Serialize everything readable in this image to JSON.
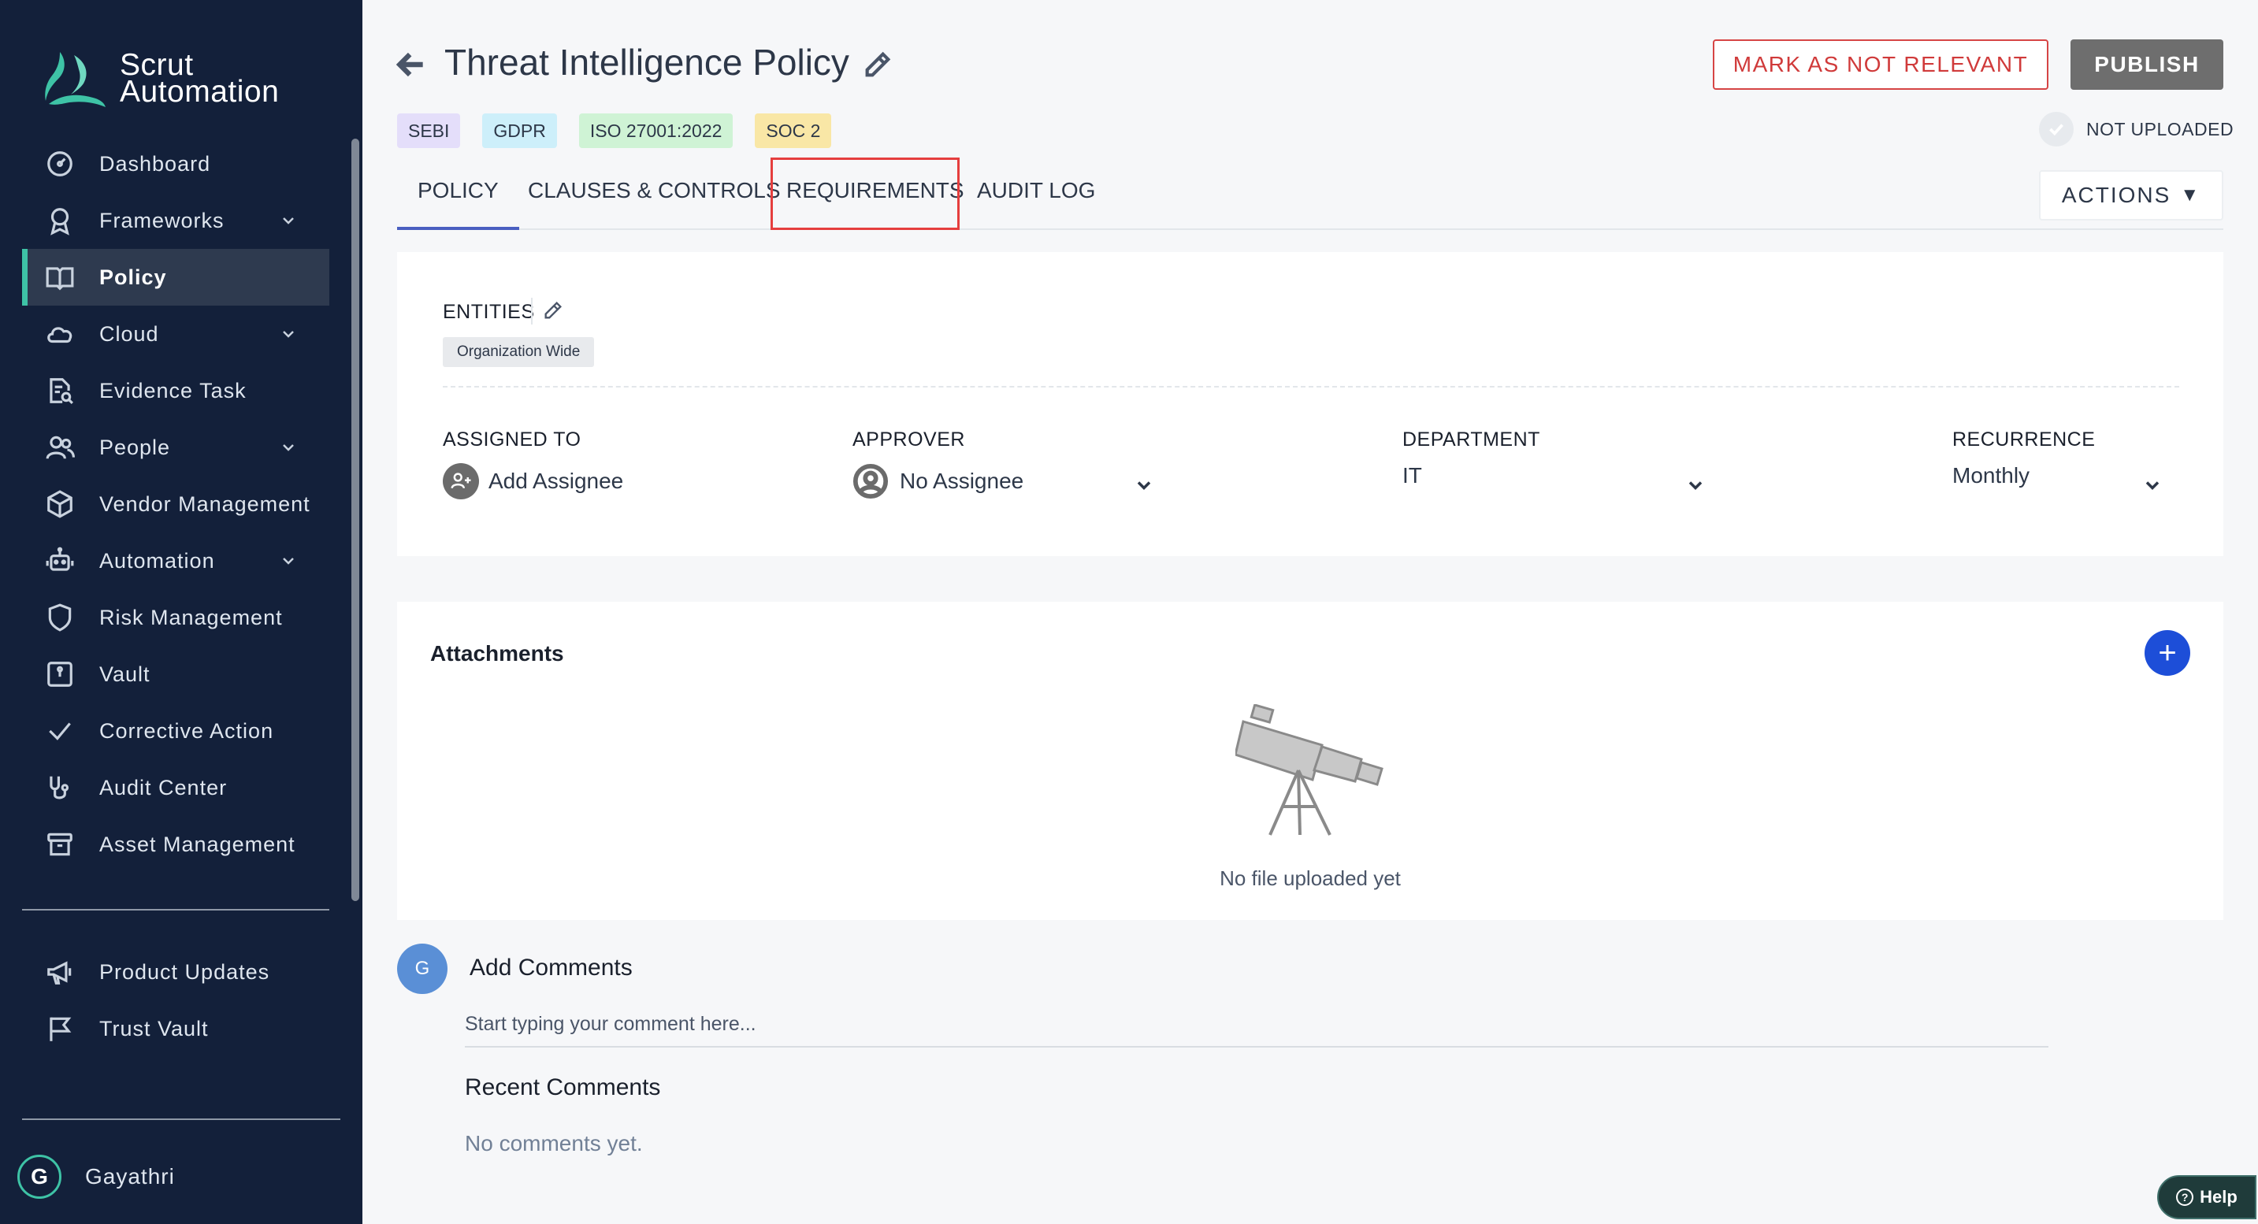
{
  "brand": {
    "line1": "Scrut",
    "line2": "Automation",
    "accent": "#3ec3a6"
  },
  "sidebar": {
    "items": [
      {
        "label": "Dashboard",
        "icon": "dashboard-gauge-icon",
        "chevron": false,
        "active": false
      },
      {
        "label": "Frameworks",
        "icon": "award-ribbon-icon",
        "chevron": true,
        "active": false
      },
      {
        "label": "Policy",
        "icon": "open-book-icon",
        "chevron": false,
        "active": true
      },
      {
        "label": "Cloud",
        "icon": "cloud-icon",
        "chevron": true,
        "active": false
      },
      {
        "label": "Evidence Task",
        "icon": "document-search-icon",
        "chevron": false,
        "active": false
      },
      {
        "label": "People",
        "icon": "people-icon",
        "chevron": true,
        "active": false
      },
      {
        "label": "Vendor Management",
        "icon": "package-icon",
        "chevron": false,
        "active": false
      },
      {
        "label": "Automation",
        "icon": "robot-icon",
        "chevron": true,
        "active": false
      },
      {
        "label": "Risk Management",
        "icon": "shield-icon",
        "chevron": false,
        "active": false
      },
      {
        "label": "Vault",
        "icon": "vault-icon",
        "chevron": false,
        "active": false
      },
      {
        "label": "Corrective Action",
        "icon": "check-icon",
        "chevron": false,
        "active": false
      },
      {
        "label": "Audit Center",
        "icon": "stethoscope-icon",
        "chevron": false,
        "active": false
      },
      {
        "label": "Asset Management",
        "icon": "archive-box-icon",
        "chevron": false,
        "active": false
      }
    ],
    "secondary": [
      {
        "label": "Product Updates",
        "icon": "megaphone-icon"
      },
      {
        "label": "Trust Vault",
        "icon": "flag-icon"
      }
    ],
    "user": {
      "initial": "G",
      "name": "Gayathri"
    }
  },
  "header": {
    "title": "Threat Intelligence Policy",
    "mark_not_relevant": "MARK AS NOT RELEVANT",
    "publish": "PUBLISH",
    "status": "NOT UPLOADED"
  },
  "tags": [
    {
      "label": "SEBI",
      "bg": "#e4defa"
    },
    {
      "label": "GDPR",
      "bg": "#cdeffa"
    },
    {
      "label": "ISO 27001:2022",
      "bg": "#cff3d5"
    },
    {
      "label": "SOC 2",
      "bg": "#f9e7a6"
    }
  ],
  "tabs": [
    {
      "label": "POLICY",
      "active": true
    },
    {
      "label": "CLAUSES & CONTROLS",
      "active": false
    },
    {
      "label": "REQUIREMENTS",
      "active": false
    },
    {
      "label": "AUDIT LOG",
      "active": false
    }
  ],
  "actions": {
    "label": "ACTIONS",
    "glyph": "▼"
  },
  "details": {
    "entities_label": "ENTITIES",
    "entity_chip": "Organization Wide",
    "assigned_to": {
      "label": "ASSIGNED TO",
      "value": "Add Assignee"
    },
    "approver": {
      "label": "APPROVER",
      "value": "No Assignee"
    },
    "department": {
      "label": "DEPARTMENT",
      "value": "IT"
    },
    "recurrence": {
      "label": "RECURRENCE",
      "value": "Monthly"
    }
  },
  "attachments": {
    "title": "Attachments",
    "add_glyph": "+",
    "empty_text": "No file uploaded yet"
  },
  "comments": {
    "avatar_initial": "G",
    "title": "Add Comments",
    "placeholder": "Start typing your comment here...",
    "recent_title": "Recent Comments",
    "empty_text": "No comments yet."
  },
  "help": {
    "label": "Help",
    "glyph": "?"
  }
}
